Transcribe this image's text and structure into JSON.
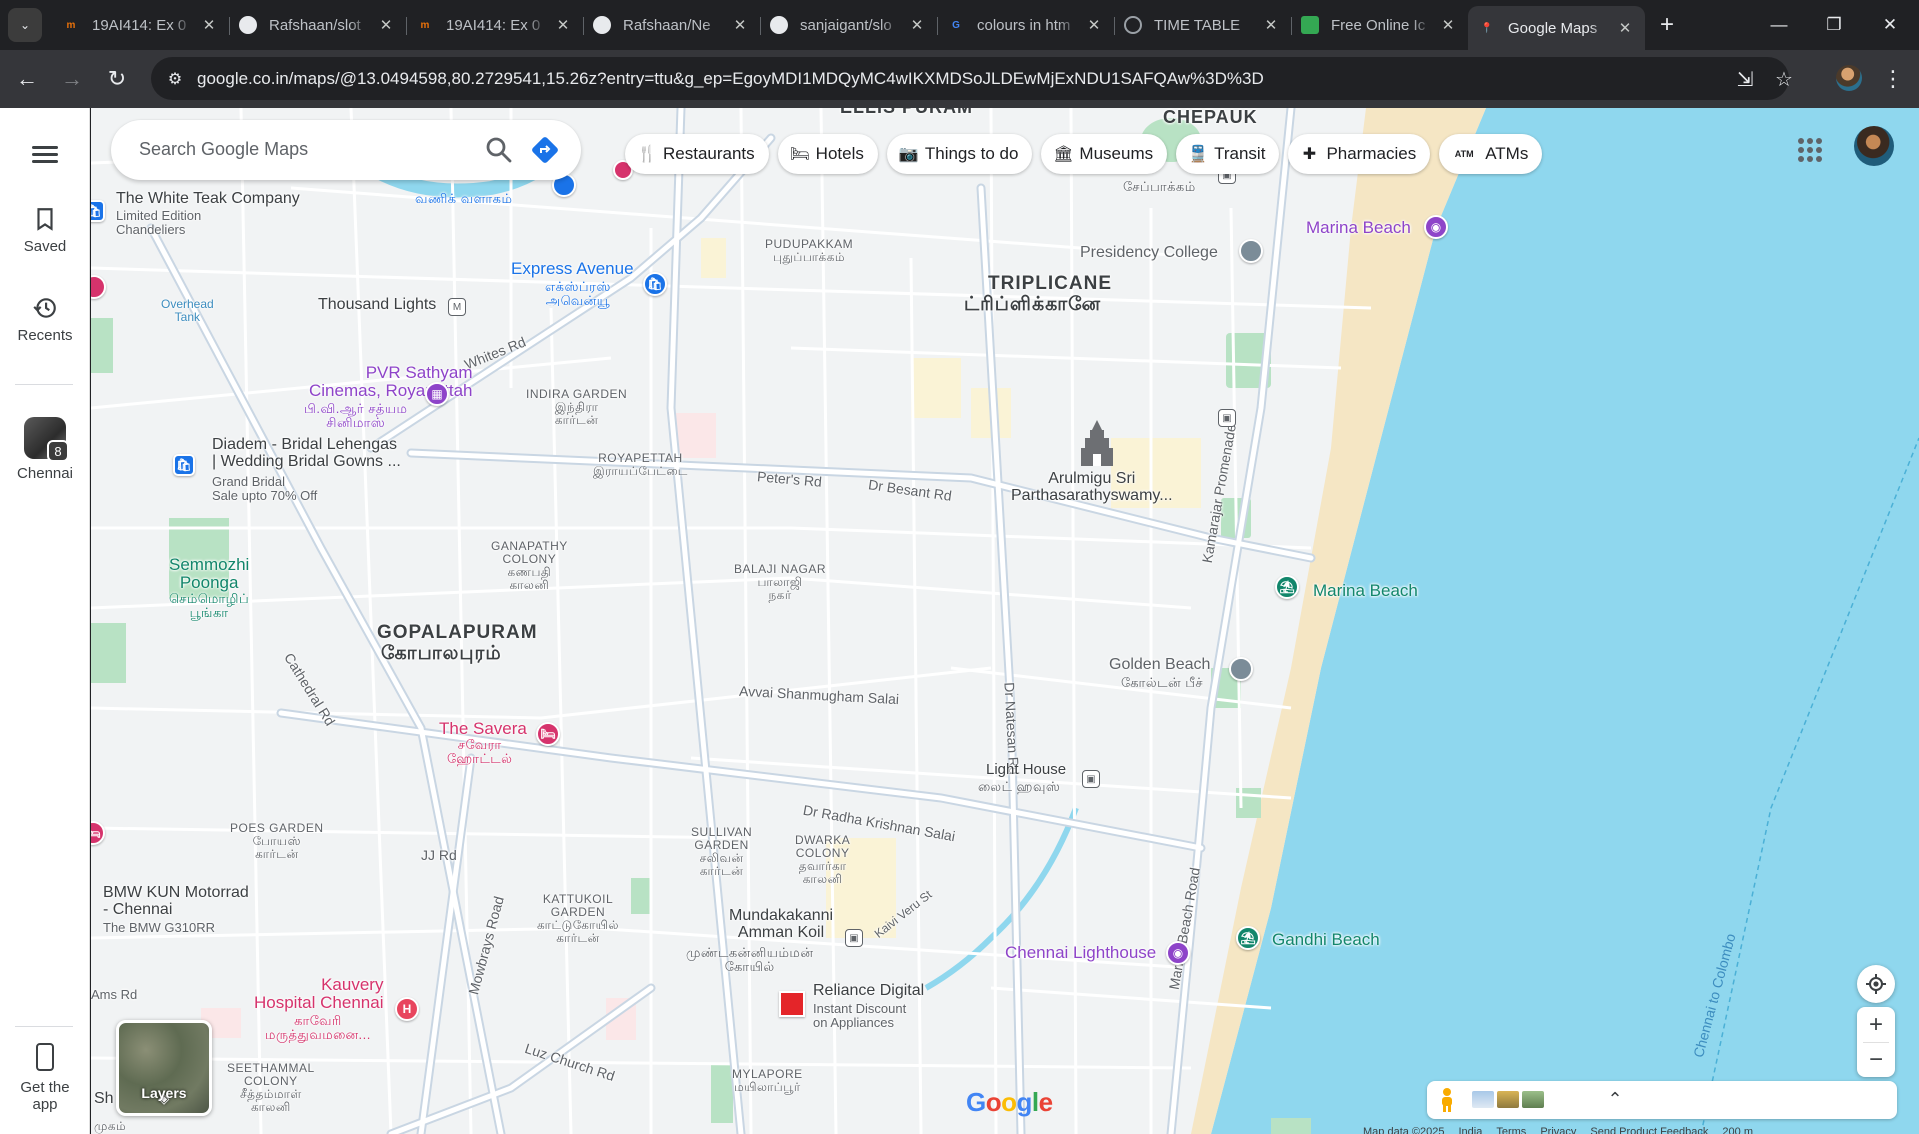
{
  "browser": {
    "tabs": [
      {
        "title": "19AI414: Ex 0",
        "favicon": "nm-icon",
        "fav_color": "#e8710a",
        "active": false
      },
      {
        "title": "Rafshaan/slot",
        "favicon": "github-icon",
        "fav_color": "#e8eaed",
        "active": false
      },
      {
        "title": "19AI414: Ex 0",
        "favicon": "nm-icon",
        "fav_color": "#e8710a",
        "active": false
      },
      {
        "title": "Rafshaan/Ne",
        "favicon": "github-icon",
        "fav_color": "#e8eaed",
        "active": false
      },
      {
        "title": "sanjaigant/slo",
        "favicon": "github-icon",
        "fav_color": "#e8eaed",
        "active": false
      },
      {
        "title": "colours in htm",
        "favicon": "google-icon",
        "fav_color": "#4285f4",
        "active": false
      },
      {
        "title": "TIME TABLE",
        "favicon": "globe-icon",
        "fav_color": "#9aa0a6",
        "active": false
      },
      {
        "title": "Free Online Ic",
        "favicon": "image-icon",
        "fav_color": "#34a853",
        "active": false
      },
      {
        "title": "Google Maps",
        "favicon": "maps-icon",
        "fav_color": "#ea4335",
        "active": true
      }
    ],
    "url": "google.co.in/maps/@13.0494598,80.2729541,15.26z?entry=ttu&g_ep=EgoyMDI1MDQyMC4wIKXMDSoJLDEwMjExNDU1SAFQAw%3D%3D",
    "new_tab": "+",
    "icons": {
      "back": "←",
      "forward": "→",
      "reload": "↻",
      "site_info": "⚙",
      "install": "⇲",
      "bookmark": "☆",
      "menu": "⋮",
      "minimize": "—",
      "restore": "❐",
      "close": "✕",
      "tab_close": "✕",
      "tab_search": "⌄"
    }
  },
  "sidebar": {
    "saved": "Saved",
    "recents": "Recents",
    "chennai": "Chennai",
    "chennai_count": "8",
    "get_app": "Get the app"
  },
  "search": {
    "placeholder": "Search Google Maps"
  },
  "chips": [
    {
      "label": "Restaurants",
      "icon": "fork-knife-icon",
      "glyph": "🍴"
    },
    {
      "label": "Hotels",
      "icon": "bed-icon",
      "glyph": "🛏"
    },
    {
      "label": "Things to do",
      "icon": "camera-icon",
      "glyph": "📷"
    },
    {
      "label": "Museums",
      "icon": "museum-icon",
      "glyph": "🏛"
    },
    {
      "label": "Transit",
      "icon": "train-icon",
      "glyph": "🚆"
    },
    {
      "label": "Pharmacies",
      "icon": "pharmacy-icon",
      "glyph": "✚"
    },
    {
      "label": "ATMs",
      "icon": "atm-icon",
      "glyph": "ATM"
    }
  ],
  "map": {
    "areas": {
      "ellis_puram": "ELLIS PURAM",
      "chepauk": "CHEPAUK",
      "chepauk_ta": "சேப்பாக்கம்",
      "triplicane": "TRIPLICANE",
      "triplicane_ta": "ட்ரிப்ளிக்கானே",
      "gopalapuram": "GOPALAPURAM",
      "gopalapuram_ta": "கோபாலபுரம்"
    },
    "localities": {
      "pudupakkam": "PUDUPAKKAM",
      "pudupakkam_ta": "புதுப்பாக்கம்",
      "indira_garden": "INDIRA GARDEN",
      "indira_garden_ta1": "இந்திரா",
      "indira_garden_ta2": "கார்டன்",
      "royapettah": "ROYAPETTAH",
      "royapettah_ta": "இராயப்பேட்டை",
      "ganapathy": "GANAPATHY",
      "ganapathy2": "COLONY",
      "ganapathy_ta1": "கணபதி",
      "ganapathy_ta2": "காலனி",
      "balaji": "BALAJI NAGAR",
      "balaji_ta1": "பாலாஜி",
      "balaji_ta2": "நகர்",
      "poes": "POES GARDEN",
      "poes_ta1": "போயஸ்",
      "poes_ta2": "கார்டன்",
      "sullivan": "SULLIVAN",
      "sullivan2": "GARDEN",
      "sullivan_ta1": "சலிவன்",
      "sullivan_ta2": "கார்டன்",
      "dwarka": "DWARKA",
      "dwarka2": "COLONY",
      "dwarka_ta1": "தவார்கா",
      "dwarka_ta2": "காலனி",
      "kattukoil": "KATTUKOIL",
      "kattukoil2": "GARDEN",
      "kattukoil_ta1": "காட்டுகோயில்",
      "kattukoil_ta2": "கார்டன்",
      "seethammal": "SEETHAMMAL",
      "seethammal2": "COLONY",
      "seethammal_ta1": "சீத்தம்மாள்",
      "seethammal_ta2": "காலனி",
      "mylapore": "MYLAPORE",
      "mylapore_ta": "மயிலாப்பூர்"
    },
    "roads": {
      "whites": "Whites Rd",
      "peters": "Peter's Rd",
      "besant": "Dr Besant Rd",
      "avvai": "Avvai Shanmugham Salai",
      "cathedral": "Cathedral Rd",
      "radha": "Dr Radha Krishnan Salai",
      "jj": "JJ Rd",
      "mowbrays": "Mowbrays Road",
      "luz": "Luz Church Rd",
      "natesan": "Dr Natesan Rd",
      "kamarajar": "Kamarajar Promenade",
      "marina_rd": "Marina Beach Road",
      "kaiveru": "Kaivi Veru St",
      "colombo": "Chennai to Colombo",
      "ams": "Ams Rd"
    },
    "places": {
      "white_teak": "The White Teak Company",
      "white_teak_sub1": "Limited Edition",
      "white_teak_sub2": "Chandeliers",
      "overhead1": "Overhead",
      "overhead2": "Tank",
      "thousand_lights": "Thousand Lights",
      "express": "Express Avenue",
      "express_ta1": "எக்ஸ்ப்ரஸ்",
      "express_ta2": "அவென்யூ",
      "vanika_ta": "வணிக் வளாகம்",
      "pvr1": "PVR Sathyam",
      "pvr2": "Cinemas, Royapettah",
      "pvr_ta1": "பி.வி.ஆர் சத்யம",
      "pvr_ta2": "சினிமாஸ்",
      "diadem1": "Diadem - Bridal Lehengas",
      "diadem2": "| Wedding Bridal Gowns ...",
      "diadem_sub1": "Grand Bridal",
      "diadem_sub2": "Sale upto 70% Off",
      "semmozhi1": "Semmozhi",
      "semmozhi2": "Poonga",
      "semmozhi_ta1": "செம்மொழிப்",
      "semmozhi_ta2": "பூங்கா",
      "presidency": "Presidency College",
      "marina1": "Marina Beach",
      "marina2": "Marina Beach",
      "arulmigu1": "Arulmigu Sri",
      "arulmigu2": "Parthasarathyswamy...",
      "golden": "Golden Beach",
      "golden_ta": "கோல்டன் பீச்",
      "savera": "The Savera",
      "savera_ta1": "சவேரா",
      "savera_ta2": "ஹோட்டல்",
      "lighthouse_metro": "Light House",
      "lighthouse_metro_ta": "லைட் ஹவுஸ்",
      "chennai_lighthouse": "Chennai Lighthouse",
      "gandhi": "Gandhi Beach",
      "bmw1": "BMW KUN Motorrad",
      "bmw2": "- Chennai",
      "bmw_sub": "The BMW G310RR",
      "mundakakanni1": "Mundakakanni",
      "mundakakanni2": "Amman Koil",
      "mundakakanni_ta1": "முண்டகன்னியம்மன்",
      "mundakakanni_ta2": "கோயில்",
      "reliance": "Reliance Digital",
      "reliance_sub1": "Instant Discount",
      "reliance_sub2": "on Appliances",
      "kauvery1": "Kauvery",
      "kauvery2": "Hospital Chennai",
      "kauvery_ta1": "காவேரி",
      "kauvery_ta2": "மருத்துவமனை...",
      "sh": "Sh",
      "mugam": "முகம்"
    },
    "layers_label": "Layers",
    "google_logo": "Google",
    "footer": [
      "Map data ©2025",
      "India",
      "Terms",
      "Privacy",
      "Send Product Feedback",
      "200 m"
    ],
    "colors": {
      "water": "#8fd7ee",
      "beach": "#f5e6c4",
      "park": "#b8e2c4",
      "road": "#ffffff",
      "land": "#f1f3f4",
      "arterial": "#c9d6e3"
    }
  }
}
